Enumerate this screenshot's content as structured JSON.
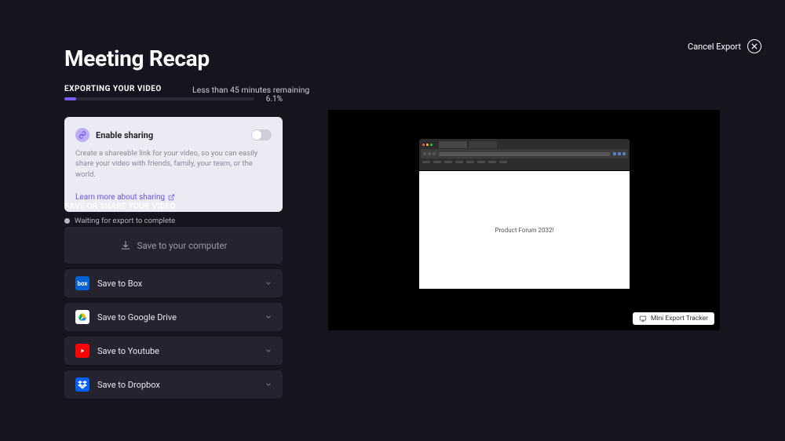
{
  "header": {
    "title": "Meeting Recap",
    "cancel_label": "Cancel Export"
  },
  "export": {
    "status_label": "EXPORTING YOUR VIDEO",
    "remaining_label": "Less than 45 minutes remaining",
    "percent": "6.1%",
    "bar_width": "6.1%"
  },
  "sharing": {
    "title": "Enable sharing",
    "description": "Create a shareable link for your video, so you can easily share your video with friends, family, your team, or the world.",
    "learn_more": "Learn more about sharing"
  },
  "save": {
    "section_label": "SAVE OR SHARE YOUR VIDEO",
    "waiting_label": "Waiting for export to complete",
    "primary_label": "Save to your computer",
    "items": [
      {
        "label": "Save to Box",
        "icon_text": "box"
      },
      {
        "label": "Save to Google Drive",
        "icon_text": ""
      },
      {
        "label": "Save to Youtube",
        "icon_text": ""
      },
      {
        "label": "Save to Dropbox",
        "icon_text": ""
      }
    ]
  },
  "preview": {
    "doc_title": "Product Forum 2032!",
    "mini_tracker_label": "Mini Export Tracker"
  }
}
